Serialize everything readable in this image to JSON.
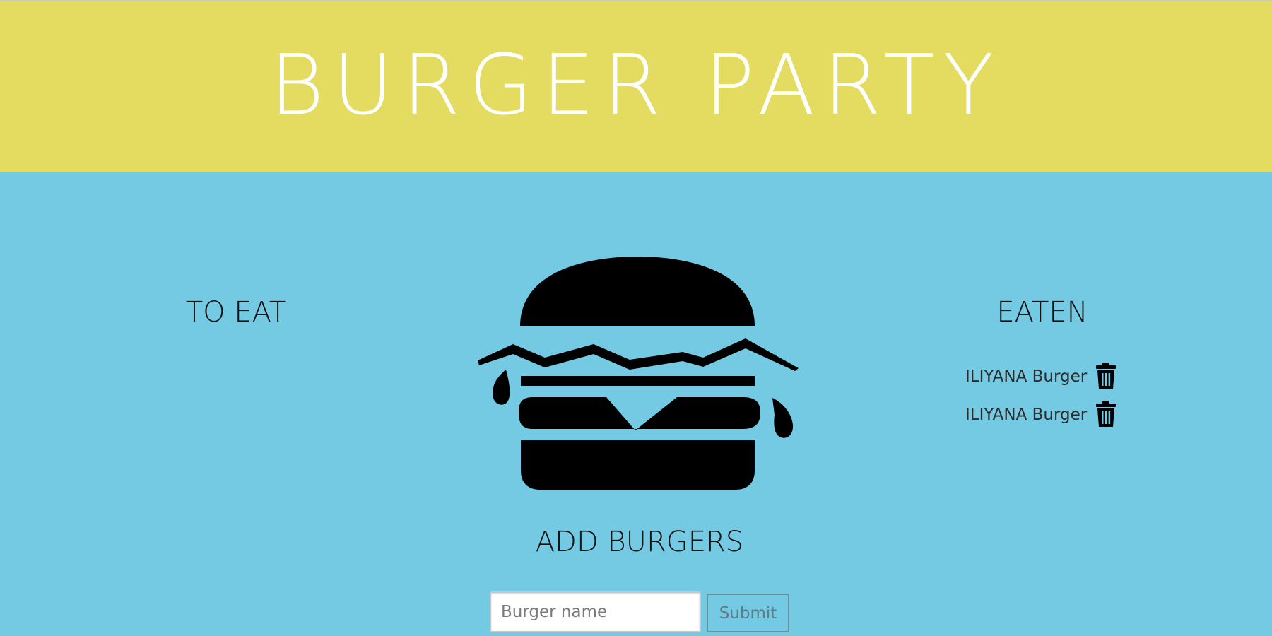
{
  "colors": {
    "header_bg": "#e4dc60",
    "body_bg": "#73cae2",
    "title_color": "#ffffff",
    "border_color": "#c9c9c9"
  },
  "header": {
    "title": "BURGER PARTY"
  },
  "to_eat": {
    "heading": "TO EAT",
    "items": []
  },
  "logo": {
    "icon": "burger-icon"
  },
  "eaten": {
    "heading": "EATEN",
    "items": [
      {
        "label": "ILIYANA Burger",
        "icon": "trash-icon"
      },
      {
        "label": "ILIYANA Burger",
        "icon": "trash-icon"
      }
    ]
  },
  "add_form": {
    "heading": "ADD BURGERS",
    "input_placeholder": "Burger name",
    "input_value": "",
    "submit_label": "Submit"
  }
}
